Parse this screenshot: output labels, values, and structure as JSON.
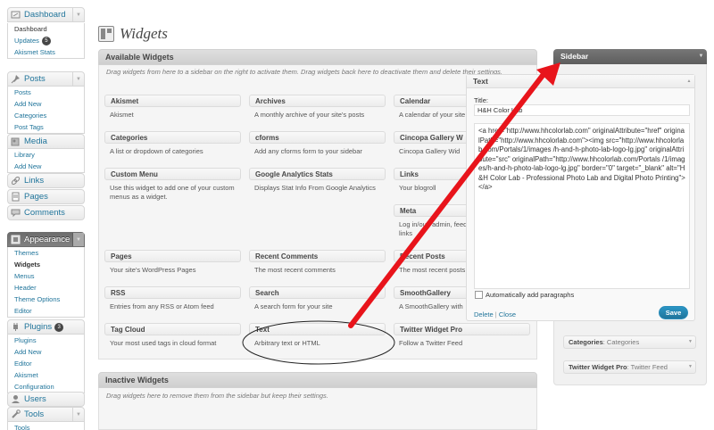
{
  "menu": {
    "dashboard": {
      "label": "Dashboard",
      "items": [
        "Dashboard",
        "Updates",
        "Akismet Stats"
      ],
      "updates_count": "5"
    },
    "posts": {
      "label": "Posts",
      "items": [
        "Posts",
        "Add New",
        "Categories",
        "Post Tags"
      ]
    },
    "media": {
      "label": "Media",
      "items": [
        "Library",
        "Add New"
      ]
    },
    "links": {
      "label": "Links"
    },
    "pages": {
      "label": "Pages"
    },
    "comments": {
      "label": "Comments"
    },
    "appearance": {
      "label": "Appearance",
      "items": [
        "Themes",
        "Widgets",
        "Menus",
        "Header",
        "Theme Options",
        "Editor"
      ]
    },
    "plugins": {
      "label": "Plugins",
      "count": "3",
      "items": [
        "Plugins",
        "Add New",
        "Editor",
        "Akismet",
        "Configuration"
      ]
    },
    "users": {
      "label": "Users"
    },
    "tools": {
      "label": "Tools",
      "items": [
        "Tools"
      ]
    }
  },
  "page_title": "Widgets",
  "available": {
    "title": "Available Widgets",
    "description": "Drag widgets from here to a sidebar on the right to activate them. Drag widgets back here to deactivate them and delete their settings.",
    "widgets": [
      {
        "title": "Akismet",
        "desc": "Akismet"
      },
      {
        "title": "Archives",
        "desc": "A monthly archive of your site's posts"
      },
      {
        "title": "Calendar",
        "desc": "A calendar of your site"
      },
      {
        "title": "Categories",
        "desc": "A list or dropdown of categories"
      },
      {
        "title": "cforms",
        "desc": "Add any cforms form to your sidebar"
      },
      {
        "title": "Cincopa Gallery W",
        "desc": "Cincopa Gallery Wid"
      },
      {
        "title": "Custom Menu",
        "desc": "Use this widget to add one of your custom menus as a widget."
      },
      {
        "title": "Google Analytics Stats",
        "desc": "Displays Stat Info From Google Analytics"
      },
      {
        "title": "Links",
        "desc": "Your blogroll"
      },
      {
        "title": "Meta",
        "desc": "Log in/out, admin, feed WordPress.org links"
      },
      {
        "title": "Pages",
        "desc": "Your site's WordPress Pages"
      },
      {
        "title": "Recent Comments",
        "desc": "The most recent comments"
      },
      {
        "title": "Recent Posts",
        "desc": "The most recent posts"
      },
      {
        "title": "RSS",
        "desc": "Entries from any RSS or Atom feed"
      },
      {
        "title": "Search",
        "desc": "A search form for your site"
      },
      {
        "title": "SmoothGallery",
        "desc": "A SmoothGallery with"
      },
      {
        "title": "Tag Cloud",
        "desc": "Your most used tags in cloud format"
      },
      {
        "title": "Text",
        "desc": "Arbitrary text or HTML"
      },
      {
        "title": "Twitter Widget Pro",
        "desc": "Follow a Twitter Feed"
      }
    ]
  },
  "inactive": {
    "title": "Inactive Widgets",
    "description": "Drag widgets here to remove them from the sidebar but keep their settings."
  },
  "sidebar": {
    "title": "Sidebar",
    "text_widget": {
      "header": "Text",
      "title_label": "Title:",
      "title_value": "H&H Color Lab",
      "content": "<a href=\"http://www.hhcolorlab.com\" originalAttribute=\"href\" originalPath=\"http://www.hhcolorlab.com\"><img src=\"http://www.hhcolorlab.com/Portals/1/images /h-and-h-photo-lab-logo-lg.jpg\" originalAttribute=\"src\" originalPath=\"http://www.hhcolorlab.com/Portals /1/images/h-and-h-photo-lab-logo-lg.jpg\" border=\"0\" target=\"_blank\" alt=\"H&H Color Lab - Professional Photo Lab and Digital Photo Printing\"></a>",
      "auto_paragraphs": "Automatically add paragraphs",
      "delete": "Delete",
      "separator": "|",
      "close": "Close",
      "save": "Save"
    },
    "categories_widget": {
      "title": "Categories",
      "sub": ": Categories"
    },
    "twitter_widget": {
      "title": "Twitter Widget Pro",
      "sub": ": Twitter Feed"
    }
  },
  "colors": {
    "annotation_arrow": "#e8141b",
    "link": "#21759b",
    "button": "#21759b"
  }
}
